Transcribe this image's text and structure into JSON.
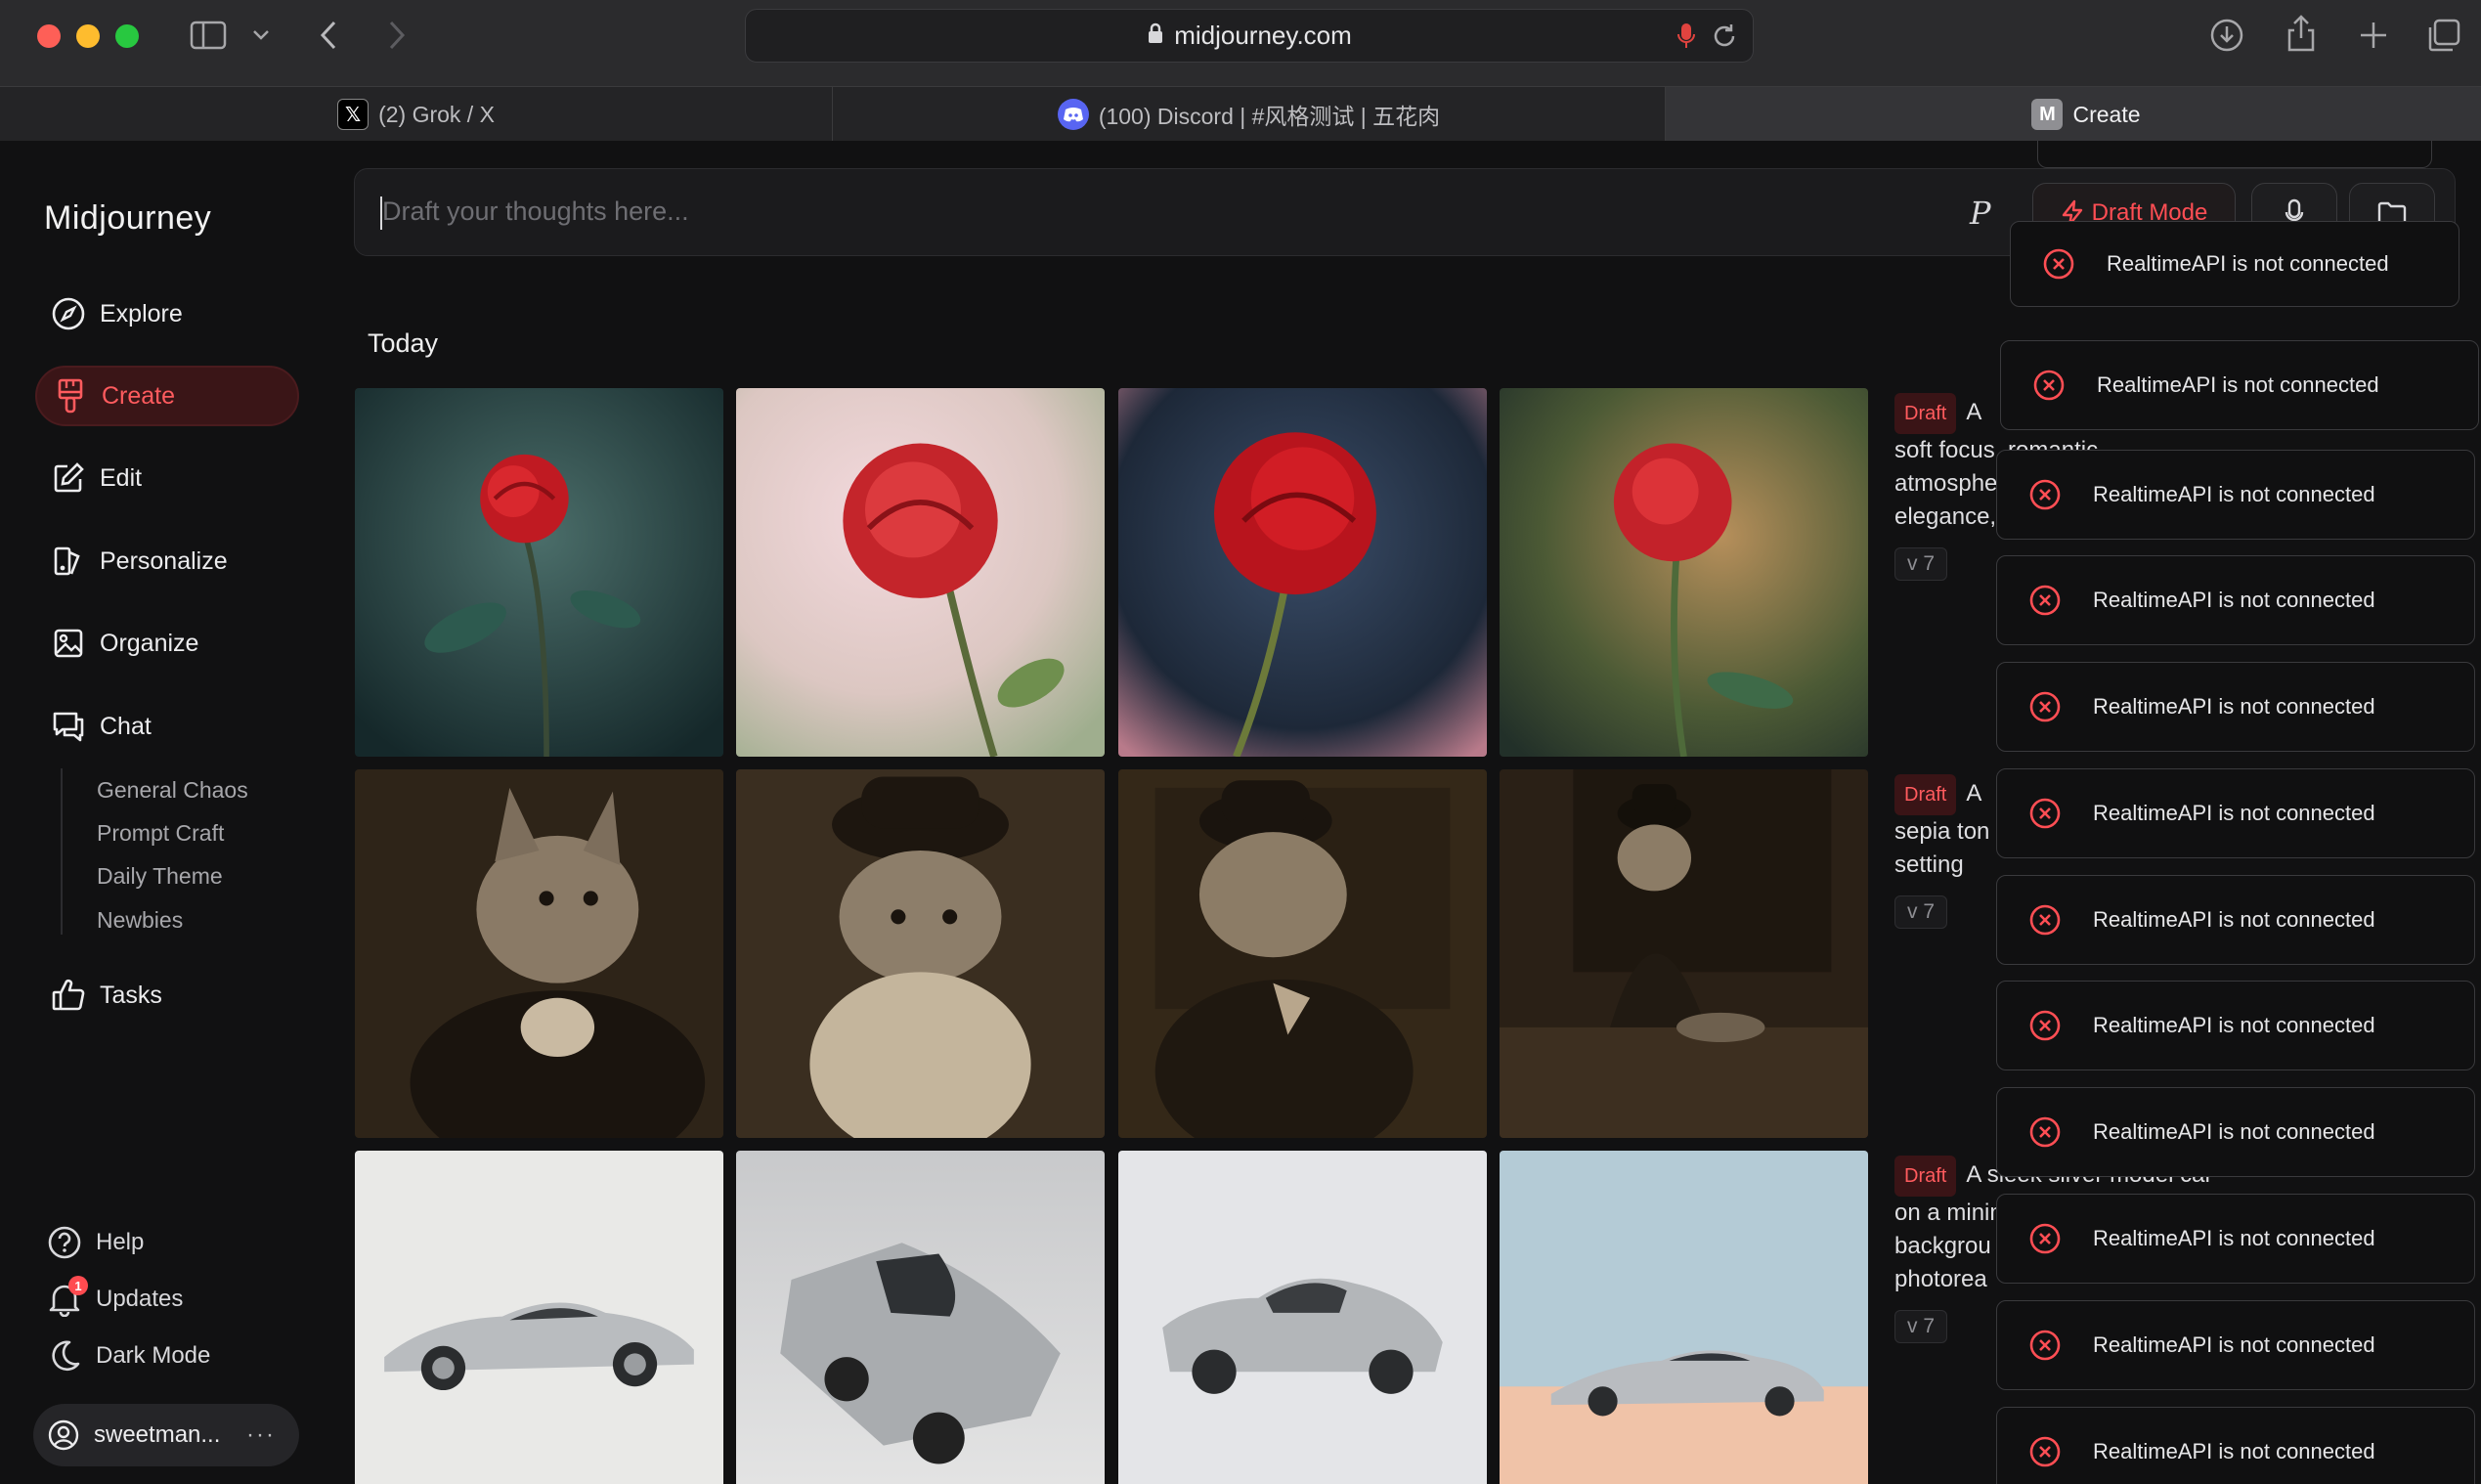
{
  "browser": {
    "url": "midjourney.com",
    "tabs": [
      {
        "label": "(2) Grok / X",
        "icon": "x-logo-icon"
      },
      {
        "label": "(100) Discord | #风格测试 | 五花肉",
        "icon": "discord-icon"
      },
      {
        "label": "Create",
        "icon": "midjourney-m-icon",
        "favicon_letter": "M"
      }
    ]
  },
  "sidebar": {
    "brand": "Midjourney",
    "nav": [
      {
        "label": "Explore",
        "icon": "compass-icon"
      },
      {
        "label": "Create",
        "icon": "brush-icon",
        "active": true
      },
      {
        "label": "Edit",
        "icon": "edit-icon"
      },
      {
        "label": "Personalize",
        "icon": "personalize-icon"
      },
      {
        "label": "Organize",
        "icon": "image-gallery-icon"
      },
      {
        "label": "Chat",
        "icon": "chat-icon"
      }
    ],
    "chat_rooms": [
      "General Chaos",
      "Prompt Craft",
      "Daily Theme",
      "Newbies"
    ],
    "tasks": {
      "label": "Tasks",
      "icon": "thumbs-up-icon"
    },
    "footer": [
      {
        "label": "Help",
        "icon": "help-icon"
      },
      {
        "label": "Updates",
        "icon": "bell-icon",
        "badge": "1"
      },
      {
        "label": "Dark Mode",
        "icon": "moon-icon"
      }
    ],
    "user": {
      "name": "sweetman...",
      "more": "···"
    }
  },
  "prompt": {
    "placeholder": "Draft your thoughts here...",
    "p_label": "P",
    "draft_mode_label": "Draft Mode"
  },
  "feed": {
    "section": "Today",
    "groups": [
      {
        "tag": "Draft",
        "line1": "A",
        "line2": "soft focus, romantic atmosphere, natural",
        "line3": "elegance,",
        "version": "v 7",
        "subject": "rose"
      },
      {
        "tag": "Draft",
        "line1": "A",
        "line2": "sepia ton",
        "line3": "setting",
        "version": "v 7",
        "subject": "cat"
      },
      {
        "tag": "Draft",
        "line1": "A sleek silver model car on a minimalist",
        "line2": "backgrou",
        "line3": "photorea",
        "version": "v 7",
        "subject": "car"
      }
    ]
  },
  "toasts": {
    "message": "RealtimeAPI is not connected",
    "count": 12
  },
  "colors": {
    "accent": "#ff4e54",
    "background": "#111112",
    "toast_error": "#ff4e54"
  }
}
